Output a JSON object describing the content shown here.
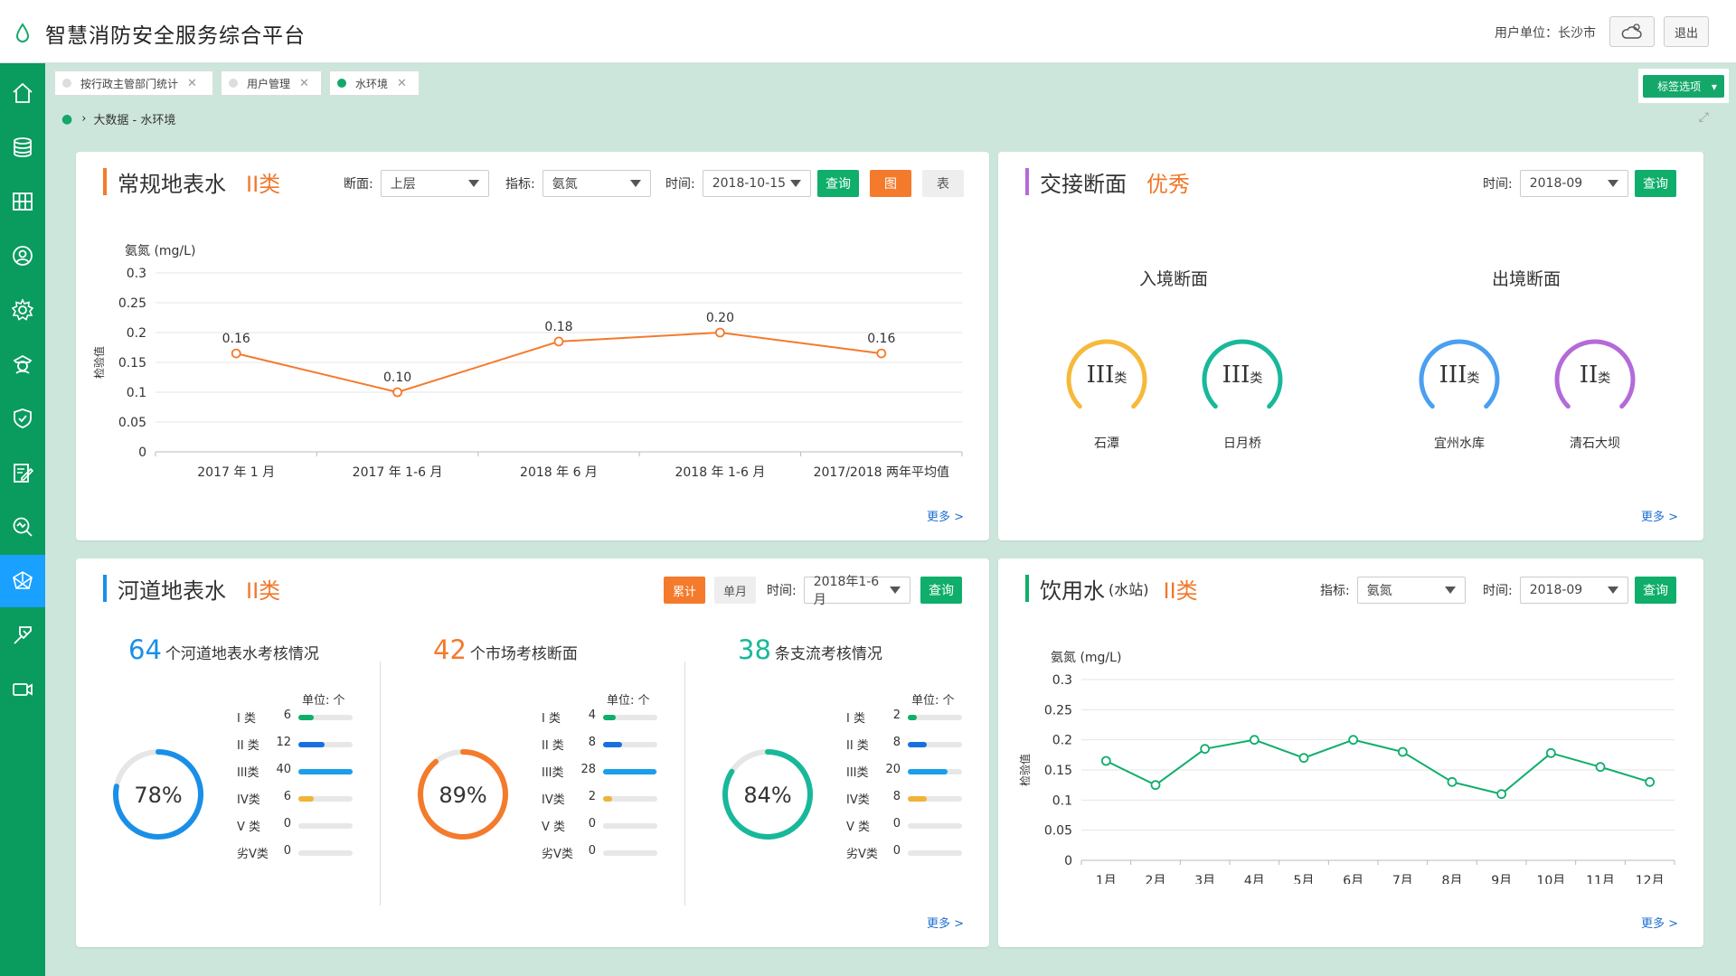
{
  "header": {
    "title": "智慧消防安全服务综合平台",
    "user_unit": "用户单位：长沙市",
    "logout": "退出"
  },
  "sidebar": {
    "items": [
      "home-icon",
      "database-icon",
      "grid-icon",
      "user-icon",
      "settings-icon",
      "police-icon",
      "shield-icon",
      "edit-icon",
      "search-icon",
      "network-icon",
      "wrench-icon",
      "video-icon"
    ],
    "active_index": 9
  },
  "tabs": [
    {
      "label": "按行政主管部门统计",
      "active": false
    },
    {
      "label": "用户管理",
      "active": false
    },
    {
      "label": "水环境",
      "active": true
    }
  ],
  "tag_options": "标签选项",
  "breadcrumb": "大数据 - 水环境",
  "colors": {
    "green": "#0fae6a",
    "orange": "#f47a2c",
    "blue": "#1a8fe8",
    "purple": "#b46ad9",
    "yellow": "#f6b93b",
    "teal": "#18b89a"
  },
  "panel1": {
    "title": "常规地表水",
    "grade": "II类",
    "section_label": "断面:",
    "section_value": "上层",
    "indicator_label": "指标:",
    "indicator_value": "氨氮",
    "time_label": "时间:",
    "time_value": "2018-10-15",
    "query": "查询",
    "chart_btn": "图",
    "table_btn": "表",
    "more": "更多 >"
  },
  "panel2": {
    "title": "交接断面",
    "grade": "优秀",
    "time_label": "时间:",
    "time_value": "2018-09",
    "query": "查询",
    "entry_title": "入境断面",
    "exit_title": "出境断面",
    "gauges": [
      {
        "grade": "III",
        "suffix": "类",
        "name": "石潭",
        "color": "#f6b93b"
      },
      {
        "grade": "III",
        "suffix": "类",
        "name": "日月桥",
        "color": "#18b89a"
      },
      {
        "grade": "III",
        "suffix": "类",
        "name": "宜州水库",
        "color": "#4a9ff0"
      },
      {
        "grade": "II",
        "suffix": "类",
        "name": "清石大坝",
        "color": "#b46ad9"
      }
    ],
    "more": "更多 >"
  },
  "panel3": {
    "title": "河道地表水",
    "grade": "II类",
    "cumulative": "累计",
    "monthly": "单月",
    "time_label": "时间:",
    "time_value": "2018年1-6月",
    "query": "查询",
    "unit": "单位: 个",
    "groups": [
      {
        "count": "64",
        "text": "个河道地表水考核情况",
        "percent": 0.78,
        "percent_label": "78%",
        "color": "#1a8fe8",
        "rows": [
          {
            "k": "I 类",
            "v": 6
          },
          {
            "k": "II 类",
            "v": 12
          },
          {
            "k": "III类",
            "v": 40
          },
          {
            "k": "IV类",
            "v": 6
          },
          {
            "k": "V 类",
            "v": 0
          },
          {
            "k": "劣V类",
            "v": 0
          }
        ]
      },
      {
        "count": "42",
        "text": "个市场考核断面",
        "percent": 0.89,
        "percent_label": "89%",
        "color": "#f47a2c",
        "rows": [
          {
            "k": "I 类",
            "v": 4
          },
          {
            "k": "II 类",
            "v": 8
          },
          {
            "k": "III类",
            "v": 28
          },
          {
            "k": "IV类",
            "v": 2
          },
          {
            "k": "V 类",
            "v": 0
          },
          {
            "k": "劣V类",
            "v": 0
          }
        ]
      },
      {
        "count": "38",
        "text": "条支流考核情况",
        "percent": 0.84,
        "percent_label": "84%",
        "color": "#18b89a",
        "rows": [
          {
            "k": "I 类",
            "v": 2
          },
          {
            "k": "II 类",
            "v": 8
          },
          {
            "k": "III类",
            "v": 20
          },
          {
            "k": "IV类",
            "v": 8
          },
          {
            "k": "V 类",
            "v": 0
          },
          {
            "k": "劣V类",
            "v": 0
          }
        ]
      }
    ],
    "more": "更多 >"
  },
  "panel4": {
    "title": "饮用水",
    "subtitle": "(水站)",
    "grade": "II类",
    "indicator_label": "指标:",
    "indicator_value": "氨氮",
    "time_label": "时间:",
    "time_value": "2018-09",
    "query": "查询",
    "more": "更多 >"
  },
  "chart_data": [
    {
      "type": "line",
      "ylabel": "检验值",
      "unit_label": "氨氮 (mg/L)",
      "categories": [
        "2017 年 1 月",
        "2017 年 1-6 月",
        "2018 年 6 月",
        "2018 年 1-6 月",
        "2017/2018 两年平均值"
      ],
      "values": [
        0.165,
        0.1,
        0.185,
        0.2,
        0.165
      ],
      "value_labels": [
        "0.16",
        "0.10",
        "0.18",
        "0.20",
        "0.16"
      ],
      "ylim": [
        0,
        0.3
      ],
      "yticks": [
        "0",
        "0.05",
        "0.1",
        "0.15",
        "0.2",
        "0.25",
        "0.3"
      ],
      "color": "#f47a2c",
      "grid": true
    },
    {
      "type": "line",
      "ylabel": "检验值",
      "unit_label": "氨氮 (mg/L)",
      "categories": [
        "1月",
        "2月",
        "3月",
        "4月",
        "5月",
        "6月",
        "7月",
        "8月",
        "9月",
        "10月",
        "11月",
        "12月"
      ],
      "values": [
        0.165,
        0.125,
        0.185,
        0.2,
        0.17,
        0.2,
        0.18,
        0.13,
        0.11,
        0.178,
        0.155,
        0.13
      ],
      "ylim": [
        0,
        0.3
      ],
      "yticks": [
        "0",
        "0.05",
        "0.1",
        "0.15",
        "0.2",
        "0.25",
        "0.3"
      ],
      "color": "#0fae6a",
      "grid": true
    }
  ]
}
